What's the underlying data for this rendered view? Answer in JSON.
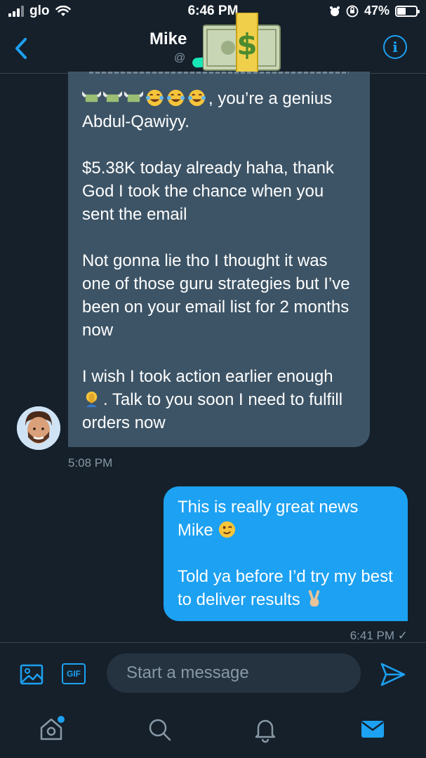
{
  "status_bar": {
    "carrier": "glo",
    "time": "6:46 PM",
    "battery_percent": "47%",
    "battery_level": 0.47
  },
  "header": {
    "contact_name": "Mike",
    "handle_prefix": "@",
    "back_icon": "chevron-left-icon",
    "info_icon": "info-icon",
    "info_glyph": "i"
  },
  "conversation": {
    "received": {
      "line1_suffix": ", you’re a genius Abdul-Qawiyy.",
      "para2": "$5.38K today already haha, thank God I took the chance when you sent the email",
      "para3": "Not gonna lie tho I thought it was one of those guru strategies but I’ve been on your email list for 2 months now",
      "para4_a": "I wish I took action earlier enough",
      "para4_b": ". Talk to you soon I need to fulfill orders now",
      "timestamp": "5:08 PM"
    },
    "sent": {
      "para1": "This is really great news Mike",
      "para2": "Told ya before I’d try my best to deliver results",
      "timestamp": "6:41 PM ✓"
    }
  },
  "composer": {
    "placeholder": "Start a message",
    "gif_label": "GIF"
  },
  "tab_bar": {
    "items": [
      "home-icon",
      "search-icon",
      "notifications-icon",
      "messages-icon"
    ],
    "active": "messages-icon"
  },
  "colors": {
    "background": "#15202b",
    "received_bubble": "#3d5466",
    "sent_bubble": "#1da1f2",
    "accent": "#1da1f2",
    "muted": "#8899a6"
  }
}
